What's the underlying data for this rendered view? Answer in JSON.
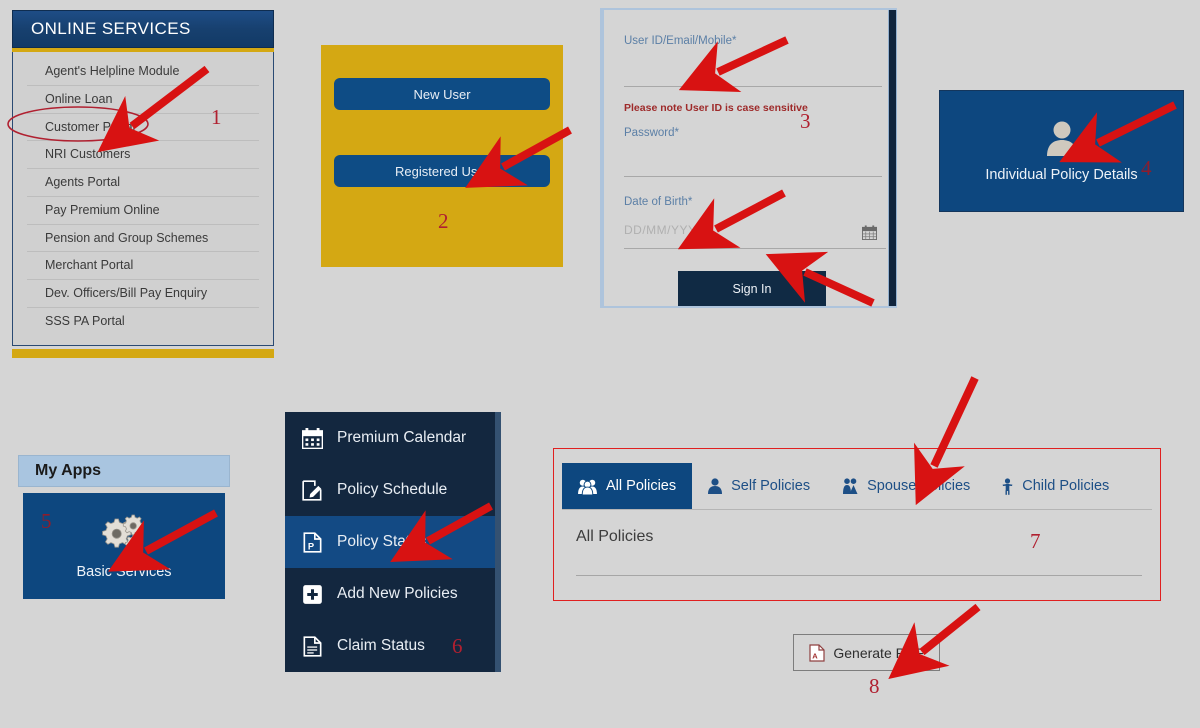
{
  "page": {
    "background_color": "#d5d5d5",
    "annotation_color": "#d81212",
    "marker_color": "#b02030"
  },
  "online_services": {
    "header": "ONLINE SERVICES",
    "items": [
      {
        "label": "Agent's Helpline Module"
      },
      {
        "label": "Online Loan"
      },
      {
        "label": "Customer Portal"
      },
      {
        "label": "NRI Customers"
      },
      {
        "label": "Agents Portal"
      },
      {
        "label": "Pay Premium Online"
      },
      {
        "label": "Pension and Group Schemes"
      },
      {
        "label": "Merchant Portal"
      },
      {
        "label": "Dev. Officers/Bill Pay Enquiry"
      },
      {
        "label": "SSS PA Portal"
      }
    ]
  },
  "user_type": {
    "new_user_label": "New User",
    "registered_user_label": "Registered User"
  },
  "login": {
    "userid_label": "User ID/Email/Mobile*",
    "userid_value": "",
    "case_note": "Please note User ID is case sensitive",
    "password_label": "Password*",
    "password_value": "",
    "dob_label": "Date of Birth*",
    "dob_placeholder": "DD/MM/YYYY",
    "dob_value": "",
    "calendar_icon": "calendar-icon",
    "signin_label": "Sign In"
  },
  "policy_tile": {
    "label": "Individual Policy Details",
    "icon": "user-icon"
  },
  "my_apps": {
    "header": "My Apps",
    "tile_label": "Basic Services",
    "tile_icon": "gears-icon"
  },
  "side_menu": {
    "items": [
      {
        "label": "Premium Calendar",
        "icon": "calendar-icon",
        "active": false
      },
      {
        "label": "Policy Schedule",
        "icon": "edit-document-icon",
        "active": false
      },
      {
        "label": "Policy Status",
        "icon": "pdf-page-icon",
        "active": true
      },
      {
        "label": "Add New Policies",
        "icon": "plus-square-icon",
        "active": false
      },
      {
        "label": "Claim Status",
        "icon": "file-icon",
        "active": false
      }
    ]
  },
  "tabs_panel": {
    "tabs": [
      {
        "label": "All Policies",
        "icon": "users-group-icon",
        "active": true
      },
      {
        "label": "Self Policies",
        "icon": "user-icon",
        "active": false
      },
      {
        "label": "Spouse Policies",
        "icon": "couple-icon",
        "active": false
      },
      {
        "label": "Child Policies",
        "icon": "child-icon",
        "active": false
      }
    ],
    "body_title": "All Policies"
  },
  "generate_pdf": {
    "label": "Generate PDF",
    "icon": "pdf-file-icon"
  },
  "markers": {
    "m1": "1",
    "m2": "2",
    "m3": "3",
    "m4": "4",
    "m5": "5",
    "m6": "6",
    "m7": "7",
    "m8": "8"
  }
}
